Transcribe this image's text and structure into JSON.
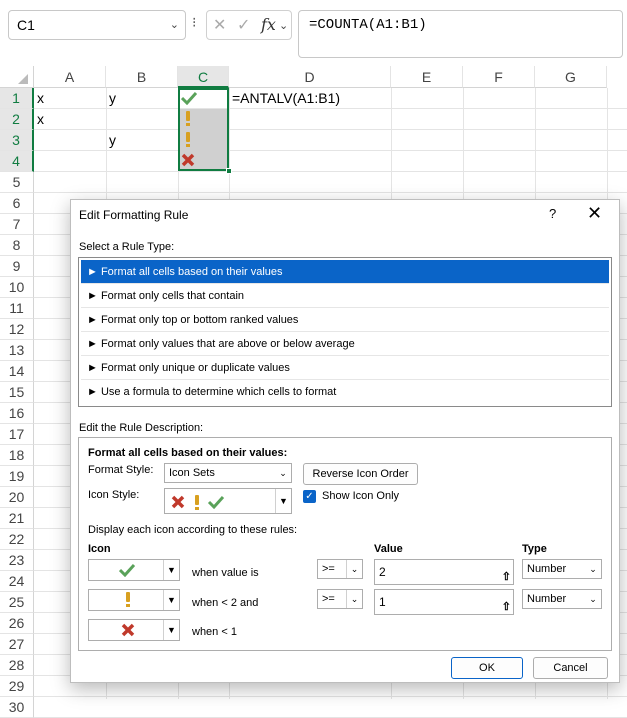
{
  "formula_bar": {
    "name_box": "C1",
    "fx": "fx",
    "cancel_icon": "✕",
    "enter_icon": "✓",
    "formula": "=COUNTA(A1:B1)"
  },
  "columns": [
    "A",
    "B",
    "C",
    "D",
    "E",
    "F",
    "G"
  ],
  "rows": [
    "1",
    "2",
    "3",
    "4",
    "5",
    "6",
    "7",
    "8",
    "9",
    "10",
    "11",
    "12",
    "13",
    "14",
    "15",
    "16",
    "17",
    "18",
    "19",
    "20",
    "21",
    "22",
    "23",
    "24",
    "25",
    "26",
    "27",
    "28",
    "29",
    "30"
  ],
  "cells": {
    "A1": "x",
    "B1": "y",
    "D1": "=ANTALV(A1:B1)",
    "A2": "x",
    "B3": "y"
  },
  "icons": {
    "check_color": "#5aa25a",
    "exclaim_color": "#d8a020",
    "cross_color": "#c0392b"
  },
  "dialog": {
    "title": "Edit Formatting Rule",
    "help": "?",
    "close": "✕",
    "select_rule_type_label": "Select a Rule Type:",
    "rule_types": [
      "► Format all cells based on their values",
      "► Format only cells that contain",
      "► Format only top or bottom ranked values",
      "► Format only values that are above or below average",
      "► Format only unique or duplicate values",
      "► Use a formula to determine which cells to format"
    ],
    "edit_description_label": "Edit the Rule Description:",
    "description_heading": "Format all cells based on their values:",
    "format_style_label": "Format Style:",
    "format_style_value": "Icon Sets",
    "reverse_icon_order": "Reverse Icon Order",
    "icon_style_label": "Icon Style:",
    "show_icon_only": "Show Icon Only",
    "display_rules_label": "Display each icon according to these rules:",
    "col_icon": "Icon",
    "col_value": "Value",
    "col_type": "Type",
    "rules": [
      {
        "text": "when value is",
        "op": ">=",
        "value": "2",
        "type": "Number"
      },
      {
        "text": "when < 2 and",
        "op": ">=",
        "value": "1",
        "type": "Number"
      },
      {
        "text": "when < 1"
      }
    ],
    "ok": "OK",
    "cancel": "Cancel"
  }
}
